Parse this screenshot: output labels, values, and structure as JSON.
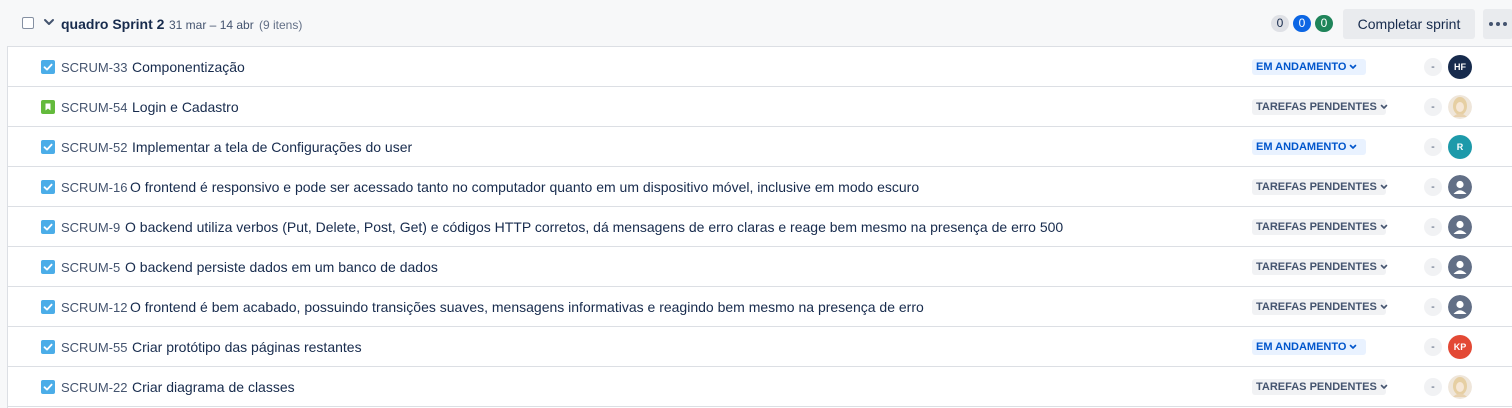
{
  "sprint": {
    "title": "quadro Sprint 2",
    "dates": "31 mar – 14 abr",
    "issue_count": "(9 itens)",
    "counts": {
      "todo": "0",
      "in_progress": "0",
      "done": "0"
    },
    "complete_label": "Completar sprint"
  },
  "issues": [
    {
      "key": "SCRUM-33",
      "summary": "Componentização",
      "type": "task",
      "status": "EM ANDAMENTO",
      "status_kind": "progress",
      "estimate": "-",
      "assignee": {
        "kind": "initials",
        "initials": "HF",
        "color": "#172b4d"
      }
    },
    {
      "key": "SCRUM-54",
      "summary": "Login e Cadastro",
      "type": "story",
      "status": "TAREFAS PENDENTES",
      "status_kind": "todo",
      "estimate": "-",
      "assignee": {
        "kind": "photo"
      }
    },
    {
      "key": "SCRUM-52",
      "summary": "Implementar a tela de Configurações do user",
      "type": "task",
      "status": "EM ANDAMENTO",
      "status_kind": "progress",
      "estimate": "-",
      "assignee": {
        "kind": "initials",
        "initials": "R",
        "color": "#1d9aaa"
      }
    },
    {
      "key": "SCRUM-16",
      "summary": "O frontend é responsivo e pode ser acessado tanto no computador quanto em um dispositivo móvel, inclusive em modo escuro",
      "type": "task",
      "status": "TAREFAS PENDENTES",
      "status_kind": "todo",
      "estimate": "-",
      "assignee": {
        "kind": "unassigned"
      }
    },
    {
      "key": "SCRUM-9",
      "summary": "O backend utiliza verbos (Put, Delete, Post, Get) e códigos HTTP corretos, dá mensagens de erro claras e reage bem mesmo na presença de erro 500",
      "type": "task",
      "status": "TAREFAS PENDENTES",
      "status_kind": "todo",
      "estimate": "-",
      "assignee": {
        "kind": "unassigned"
      }
    },
    {
      "key": "SCRUM-5",
      "summary": "O backend persiste dados em um banco de dados",
      "type": "task",
      "status": "TAREFAS PENDENTES",
      "status_kind": "todo",
      "estimate": "-",
      "assignee": {
        "kind": "unassigned"
      }
    },
    {
      "key": "SCRUM-12",
      "summary": "O frontend é bem acabado, possuindo transições suaves, mensagens informativas e reagindo bem mesmo na presença de erro",
      "type": "task",
      "status": "TAREFAS PENDENTES",
      "status_kind": "todo",
      "estimate": "-",
      "assignee": {
        "kind": "unassigned"
      }
    },
    {
      "key": "SCRUM-55",
      "summary": "Criar protótipo das páginas restantes",
      "type": "task",
      "status": "EM ANDAMENTO",
      "status_kind": "progress",
      "estimate": "-",
      "assignee": {
        "kind": "initials",
        "initials": "KP",
        "color": "#e34935"
      }
    },
    {
      "key": "SCRUM-22",
      "summary": "Criar diagrama de classes",
      "type": "task",
      "status": "TAREFAS PENDENTES",
      "status_kind": "todo",
      "estimate": "-",
      "assignee": {
        "kind": "photo"
      }
    }
  ],
  "colors": {
    "task_icon": "#4bade8",
    "story_icon": "#63ba3c",
    "unassigned_avatar": "#626f86"
  }
}
